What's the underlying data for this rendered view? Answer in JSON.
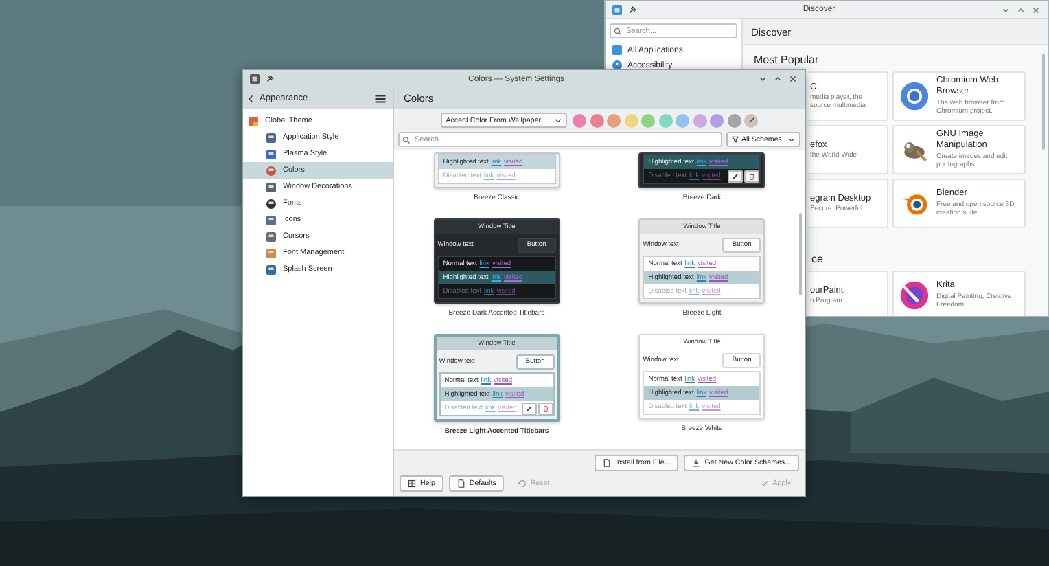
{
  "discover": {
    "title": "Discover",
    "search": {
      "placeholder": "Search..."
    },
    "categories": [
      {
        "label": "All Applications",
        "selected": false
      },
      {
        "label": "Accessibility",
        "selected": false
      }
    ],
    "heading": "Discover",
    "sections": [
      {
        "title": "Most Popular",
        "apps": [
          {
            "kind": "partial",
            "name": "C",
            "description": "media player, the source multimedia"
          },
          {
            "kind": "full",
            "name": "Chromium Web Browser",
            "description": "The web browser from Chromium project."
          },
          {
            "kind": "partial",
            "name": "efox",
            "description": "the World Wide"
          },
          {
            "kind": "full",
            "name": "GNU Image Manipulation",
            "description": "Create images and edit photographs"
          },
          {
            "kind": "partial",
            "name": "egram Desktop",
            "description": "Secure. Powerful"
          },
          {
            "kind": "full",
            "name": "Blender",
            "description": "Free and open source 3D creation suite"
          }
        ]
      },
      {
        "title": "ce",
        "apps": [
          {
            "kind": "partial",
            "name": "ourPaint",
            "description": "n Program"
          },
          {
            "kind": "full",
            "name": "Krita",
            "description": "Digital Painting, Creative Freedom"
          }
        ]
      }
    ]
  },
  "settings": {
    "title": "Colors — System Settings",
    "back_label": "Appearance",
    "sidebar": [
      {
        "label": "Global Theme",
        "selected": false,
        "children": [
          {
            "label": "Application Style",
            "selected": false
          },
          {
            "label": "Plasma Style",
            "selected": false
          },
          {
            "label": "Colors",
            "selected": true
          },
          {
            "label": "Window Decorations",
            "selected": false
          },
          {
            "label": "Fonts",
            "selected": false
          },
          {
            "label": "Icons",
            "selected": false
          },
          {
            "label": "Cursors",
            "selected": false
          },
          {
            "label": "Font Management",
            "selected": false
          },
          {
            "label": "Splash Screen",
            "selected": false
          }
        ]
      }
    ],
    "page_title": "Colors",
    "accent_dropdown": "Accent Color From Wallpaper",
    "accent_colors": [
      {
        "color": "#ea7fb2",
        "selected": false
      },
      {
        "color": "#e7828c",
        "selected": false
      },
      {
        "color": "#eb9c7c",
        "selected": false
      },
      {
        "color": "#efd77c",
        "selected": false
      },
      {
        "color": "#8fd480",
        "selected": false
      },
      {
        "color": "#82d7c6",
        "selected": false
      },
      {
        "color": "#8ec5ec",
        "selected": false
      },
      {
        "color": "#cba8e6",
        "selected": false
      },
      {
        "color": "#b39de9",
        "selected": false
      },
      {
        "color": "#a3a5aa",
        "selected": false
      }
    ],
    "search": {
      "placeholder": "Search..."
    },
    "filter": "All Schemes",
    "schemes": [
      {
        "name": "Breeze Classic",
        "kind": "classic",
        "selected": false,
        "actions": false,
        "preview": {
          "rows": [
            {
              "kind": "highlighted",
              "text": "Highlighted text",
              "link": "link",
              "visited": "visited"
            },
            {
              "kind": "disabled",
              "text": "Disabled text",
              "link": "link",
              "visited": "visited"
            }
          ]
        }
      },
      {
        "name": "Breeze Dark",
        "kind": "dark",
        "selected": false,
        "actions": true,
        "preview": {
          "rows": [
            {
              "kind": "highlighted",
              "text": "Highlighted text",
              "link": "link",
              "visited": "visited"
            },
            {
              "kind": "disabled",
              "text": "Disabled text",
              "link": "link",
              "visited": "visited"
            }
          ]
        }
      },
      {
        "name": "Breeze Dark Accented Titlebars",
        "kind": "dark",
        "selected": false,
        "actions": false,
        "preview": {
          "title": "Window Title",
          "window_text": "Window text",
          "button": "Button",
          "rows": [
            {
              "kind": "normal",
              "text": "Normal text",
              "link": "link",
              "visited": "visited"
            },
            {
              "kind": "highlighted",
              "text": "Highlighted text",
              "link": "link",
              "visited": "visited"
            },
            {
              "kind": "disabled",
              "text": "Disabled text",
              "link": "link",
              "visited": "visited"
            }
          ]
        }
      },
      {
        "name": "Breeze Light",
        "kind": "light",
        "selected": false,
        "actions": false,
        "preview": {
          "title": "Window Title",
          "window_text": "Window text",
          "button": "Button",
          "rows": [
            {
              "kind": "normal",
              "text": "Normal text",
              "link": "link",
              "visited": "visited"
            },
            {
              "kind": "highlighted",
              "text": "Highlighted text",
              "link": "link",
              "visited": "visited"
            },
            {
              "kind": "disabled",
              "text": "Disabled text",
              "link": "link",
              "visited": "visited"
            }
          ]
        }
      },
      {
        "name": "Breeze Light Accented Titlebars",
        "kind": "light-accented",
        "selected": true,
        "actions": true,
        "preview": {
          "title": "Window Title",
          "window_text": "Window text",
          "button": "Button",
          "rows": [
            {
              "kind": "normal",
              "text": "Normal text",
              "link": "link",
              "visited": "visited"
            },
            {
              "kind": "highlighted",
              "text": "Highlighted text",
              "link": "link",
              "visited": "visited"
            },
            {
              "kind": "disabled",
              "text": "Disabled text",
              "link": "link",
              "visited": "visited"
            }
          ]
        }
      },
      {
        "name": "Breeze White",
        "kind": "white",
        "selected": false,
        "actions": false,
        "preview": {
          "title": "Window Title",
          "window_text": "Window text",
          "button": "Button",
          "rows": [
            {
              "kind": "normal",
              "text": "Normal text",
              "link": "link",
              "visited": "visited"
            },
            {
              "kind": "highlighted",
              "text": "Highlighted text",
              "link": "link",
              "visited": "visited"
            },
            {
              "kind": "disabled",
              "text": "Disabled text",
              "link": "link",
              "visited": "visited"
            }
          ]
        }
      }
    ],
    "actions": [
      {
        "label": "Install from File...",
        "disabled": false
      },
      {
        "label": "Get New Color Schemes...",
        "disabled": false
      }
    ],
    "footer_buttons": [
      {
        "label": "Help",
        "disabled": false
      },
      {
        "label": "Defaults",
        "disabled": false
      },
      {
        "label": "Reset",
        "disabled": true
      },
      {
        "label": "Apply",
        "disabled": true
      }
    ]
  }
}
